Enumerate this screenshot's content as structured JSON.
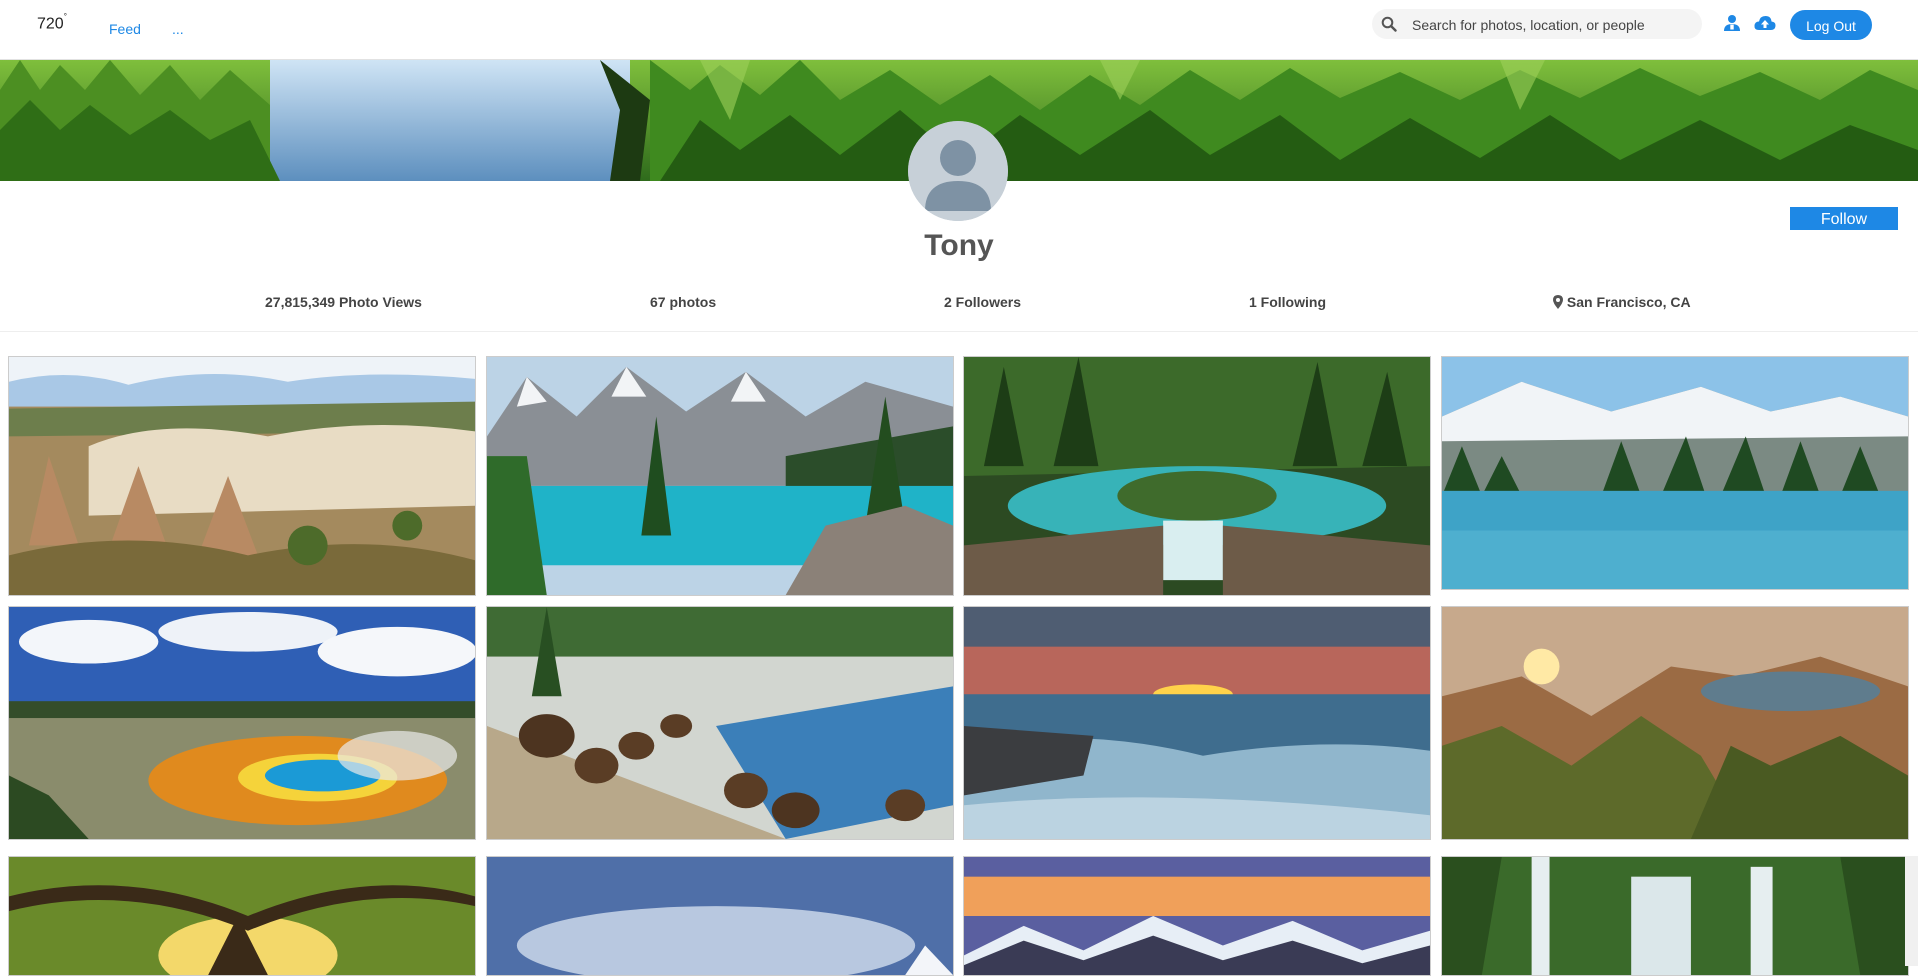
{
  "nav": {
    "logo": "720",
    "logo_sup": "°",
    "links": [
      "Feed",
      "..."
    ],
    "search_placeholder": "Search for photos, location, or people",
    "logout_label": "Log Out"
  },
  "profile": {
    "name": "Tony",
    "follow_label": "Follow",
    "stats": {
      "photo_views": "27,815,349 Photo Views",
      "photos": "67 photos",
      "followers": "2 Followers",
      "following": "1 Following",
      "location": "San Francisco, CA"
    }
  },
  "colors": {
    "accent": "#1e88e5"
  },
  "icons": [
    "search-icon",
    "user-icon",
    "upload-cloud-icon",
    "map-pin-icon"
  ],
  "photos": [
    {
      "subject": "rock-formations"
    },
    {
      "subject": "turquoise-mountain-lake"
    },
    {
      "subject": "river-waterfall-forest"
    },
    {
      "subject": "snowy-mountains-lake"
    },
    {
      "subject": "grand-prismatic-spring"
    },
    {
      "subject": "bison-herd-river"
    },
    {
      "subject": "ocean-sunset-rocks"
    },
    {
      "subject": "mountain-lake-sunrise"
    },
    {
      "subject": "oak-tree-sunlight"
    },
    {
      "subject": "blue-sky-peak"
    },
    {
      "subject": "snowy-range-dusk"
    },
    {
      "subject": "jungle-waterfall"
    }
  ]
}
